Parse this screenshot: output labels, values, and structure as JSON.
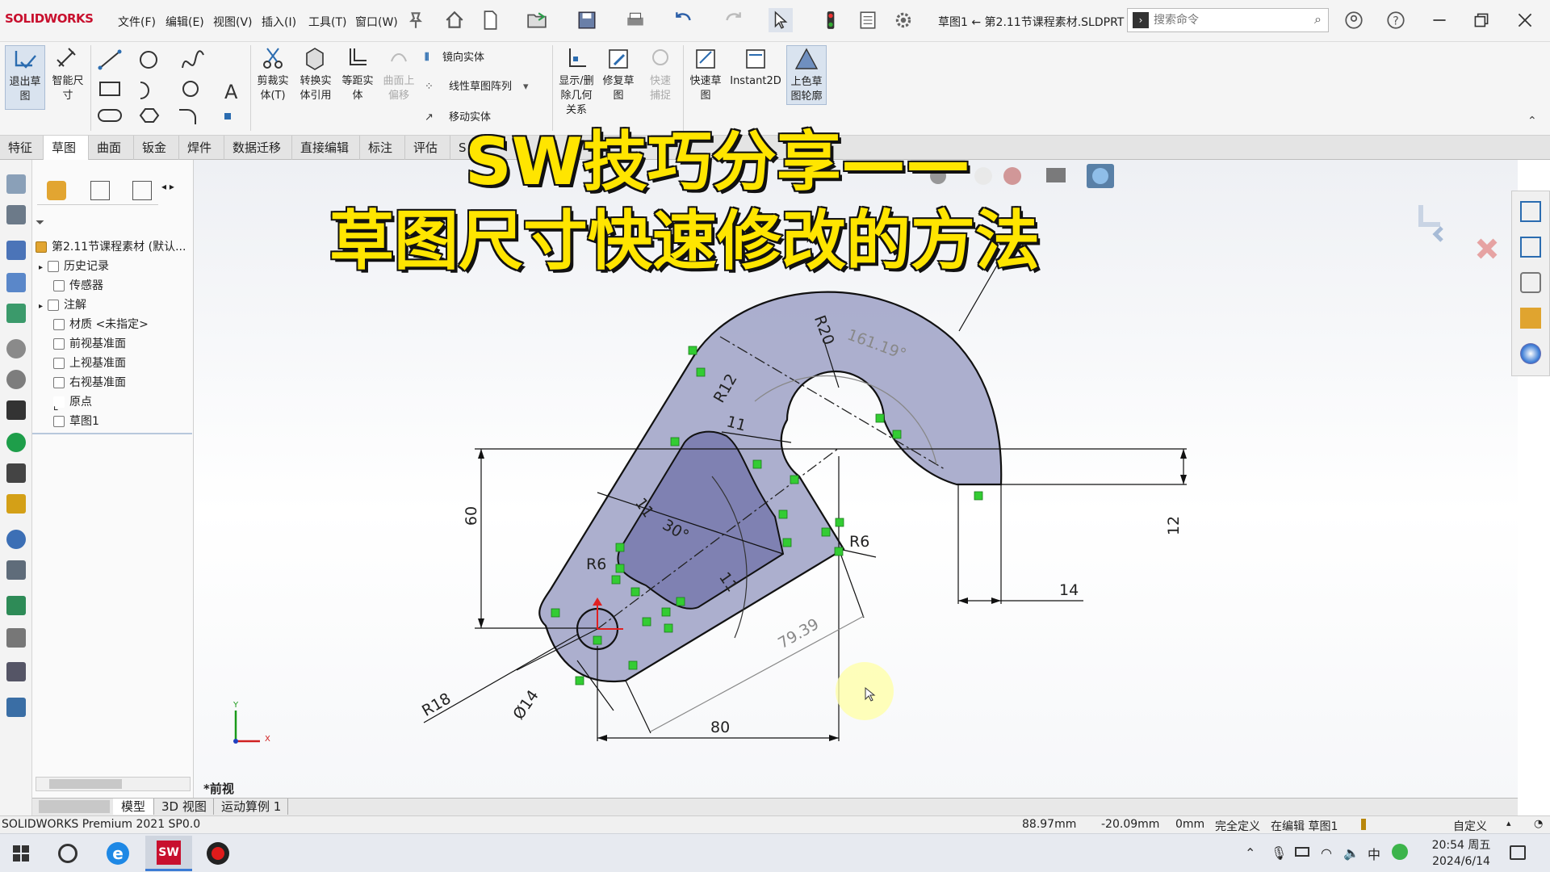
{
  "app": {
    "brand": "SOLIDWORKS",
    "doc_title": "草图1 ← 第2.11节课程素材.SLDPRT *",
    "search_placeholder": "搜索命令"
  },
  "menu": [
    "文件(F)",
    "编辑(E)",
    "视图(V)",
    "插入(I)",
    "工具(T)",
    "窗口(W)"
  ],
  "commands": {
    "exit_sketch": "退出草图",
    "smart_dim": "智能尺寸",
    "trim": "剪裁实体(T)",
    "convert": "转换实体引用",
    "offset": "等距实体",
    "surface_offset": "曲面上偏移",
    "mirror": "镜向实体",
    "linear_pattern": "线性草图阵列",
    "move": "移动实体",
    "show_relations": "显示/删除几何关系",
    "repair": "修复草图",
    "quick_snap": "快速捕捉",
    "rapid_sketch": "快速草图",
    "instant2d": "Instant2D",
    "shaded_contours": "上色草图轮廓"
  },
  "tabs": [
    "特征",
    "草图",
    "曲面",
    "钣金",
    "焊件",
    "数据迁移",
    "直接编辑",
    "标注",
    "评估",
    "S"
  ],
  "tree": {
    "root": "第2.11节课程素材 (默认...",
    "items": [
      "历史记录",
      "传感器",
      "注解",
      "材质 <未指定>",
      "前视基准面",
      "上视基准面",
      "右视基准面",
      "原点",
      "草图1"
    ]
  },
  "headline": {
    "line1": "SW技巧分享——",
    "line2": "草图尺寸快速修改的方法"
  },
  "dimensions": {
    "r20": "R20",
    "angle_161": "161.19°",
    "r12": "R12",
    "d11_top": "11",
    "d60": "60",
    "d12": "12",
    "d14": "14",
    "d11_left": "11",
    "angle_30": "30°",
    "r6_right": "R6",
    "r6_left": "R6",
    "d11_bottom": "11",
    "d79": "79.39",
    "d80": "80",
    "r18": "R18",
    "phi14": "Ø14"
  },
  "view_label": "*前视",
  "bottom_tabs": [
    "模型",
    "3D 视图",
    "运动算例 1"
  ],
  "status": {
    "product": "SOLIDWORKS Premium 2021 SP0.0",
    "x": "88.97mm",
    "y": "-20.09mm",
    "z": "0mm",
    "state": "完全定义",
    "mode": "在编辑 草图1",
    "units": "自定义"
  },
  "taskbar": {
    "time": "20:54 周五",
    "date": "2024/6/14"
  },
  "colors": {
    "part_fill": "#a3a6c9",
    "accent_yellow": "#ffe500",
    "brand_red": "#c8102e",
    "relation_green": "#33cc33"
  }
}
